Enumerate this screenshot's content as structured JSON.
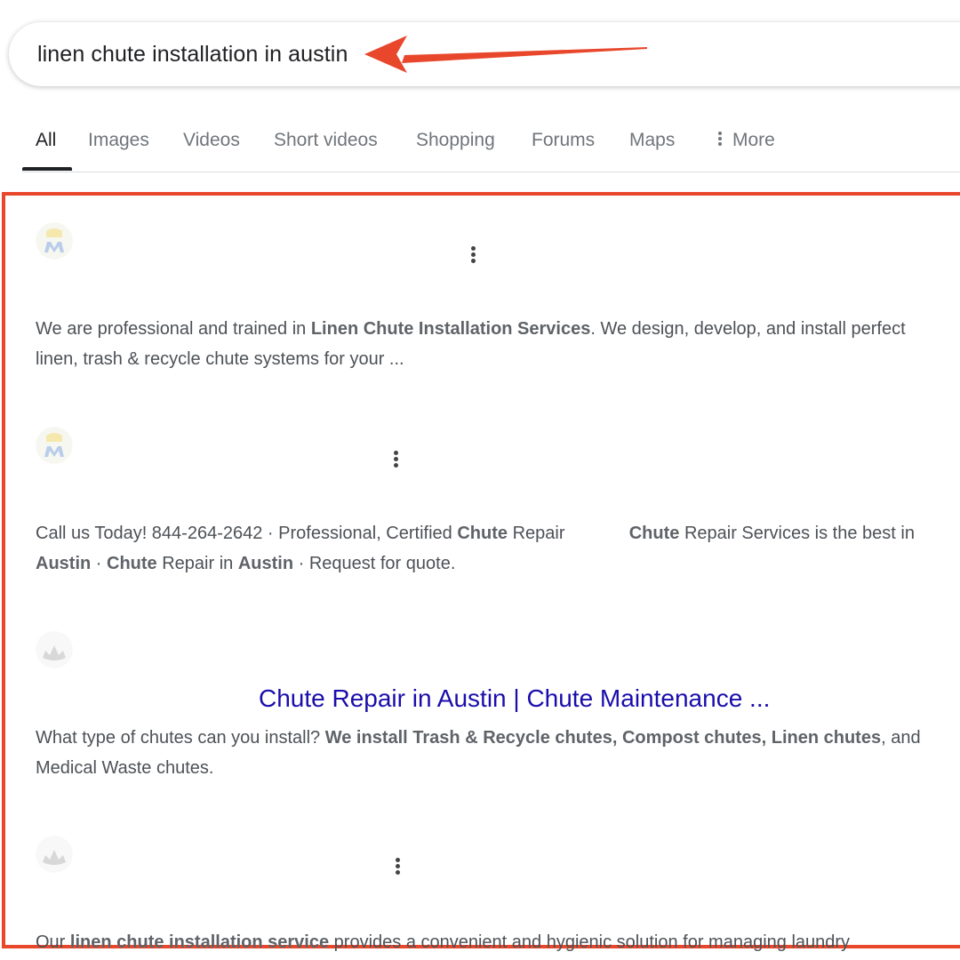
{
  "search": {
    "query": "linen chute installation in austin"
  },
  "tabs": [
    {
      "label": "All",
      "active": true
    },
    {
      "label": "Images"
    },
    {
      "label": "Videos"
    },
    {
      "label": "Short videos"
    },
    {
      "label": "Shopping"
    },
    {
      "label": "Forums"
    },
    {
      "label": "Maps"
    },
    {
      "label": "More"
    }
  ],
  "colors": {
    "highlight": "#e8472b",
    "arrow": "#e8472b",
    "link": "#1a0dab",
    "snippet": "#4d5156"
  },
  "icons": {
    "more": "vertical-dots-icon",
    "result_menu": "kebab-menu-icon",
    "favicon_1": "m-logo-icon",
    "favicon_3": "crown-logo-icon"
  },
  "results": [
    {
      "snippet": [
        {
          "t": "We are professional and trained in "
        },
        {
          "t": "Linen Chute Installation Services",
          "b": true
        },
        {
          "t": ". We design, develop, and install perfect linen, trash & recycle chute systems for your ..."
        }
      ]
    },
    {
      "snippet": [
        {
          "t": "Call us Today! 844-264-2642 · Professional, Certified "
        },
        {
          "t": "Chute",
          "b": true
        },
        {
          "t": " Repair             "
        },
        {
          "t": "Chute",
          "b": true
        },
        {
          "t": " Repair Services is the best in "
        },
        {
          "t": "Austin",
          "b": true
        },
        {
          "t": " · "
        },
        {
          "t": "Chute",
          "b": true
        },
        {
          "t": " Repair in "
        },
        {
          "t": "Austin",
          "b": true
        },
        {
          "t": " · Request for quote."
        }
      ]
    },
    {
      "title": "Chute Repair in Austin | Chute Maintenance ...",
      "snippet": [
        {
          "t": "What type of chutes can you install? "
        },
        {
          "t": "We install Trash & Recycle chutes, Compost chutes, Linen chutes",
          "b": true
        },
        {
          "t": ", and Medical Waste chutes."
        }
      ]
    },
    {
      "snippet": [
        {
          "t": "Our "
        },
        {
          "t": "linen chute installation service",
          "b": true
        },
        {
          "t": " provides a convenient and hygienic solution for managing laundry"
        }
      ]
    }
  ]
}
